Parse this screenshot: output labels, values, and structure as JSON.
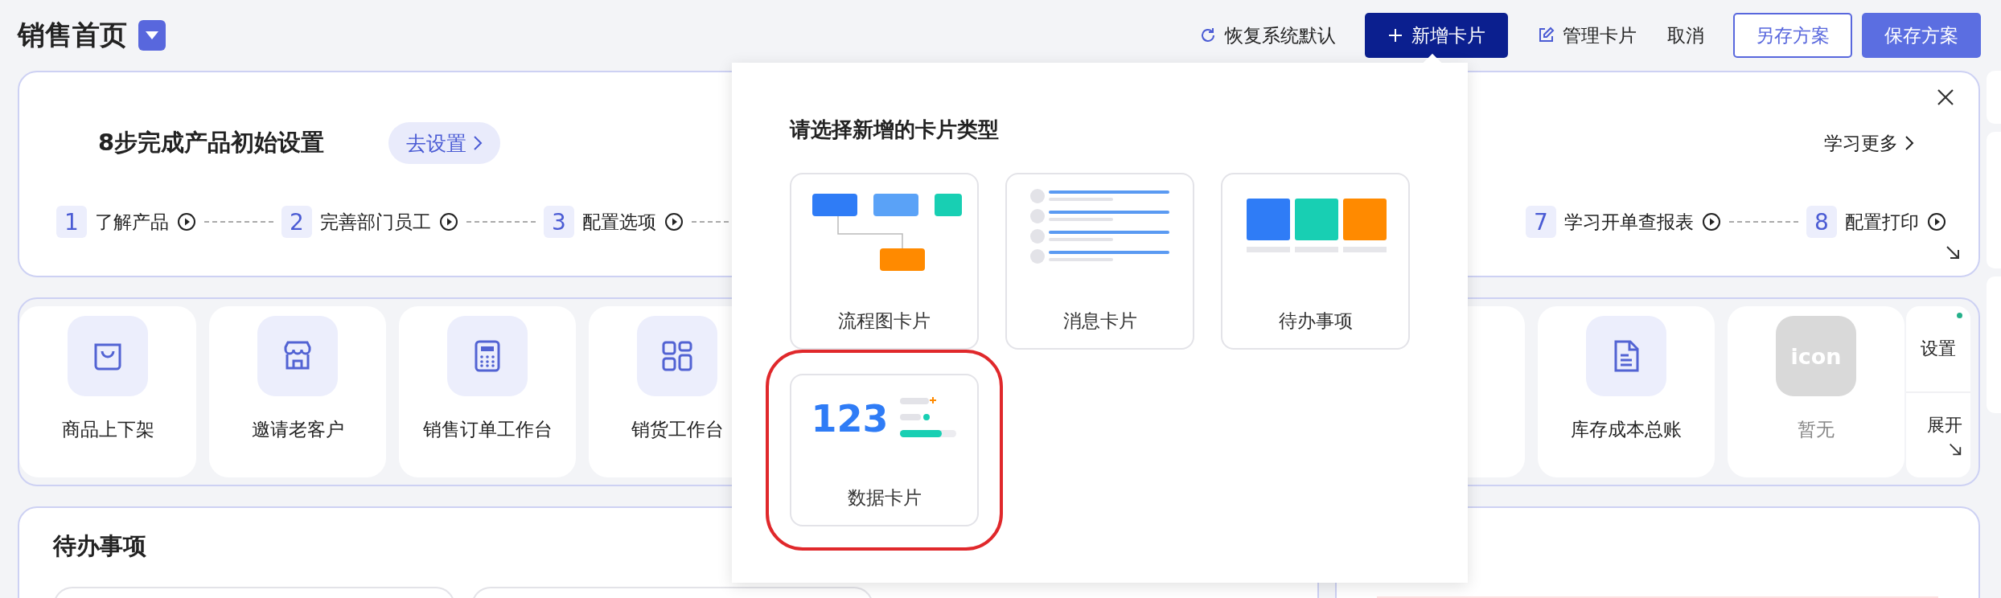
{
  "page": {
    "title": "销售首页"
  },
  "toolbar": [
    {
      "kind": "reset",
      "label": "恢复系统默认"
    },
    {
      "kind": "add",
      "label": "新增卡片"
    },
    {
      "kind": "manage",
      "label": "管理卡片"
    },
    {
      "kind": "cancel",
      "label": "取消"
    },
    {
      "kind": "save-as",
      "label": "另存方案"
    },
    {
      "kind": "save",
      "label": "保存方案"
    }
  ],
  "setup": {
    "title": "8步完成产品初始设置",
    "action": "去设置",
    "more": "学习更多",
    "steps_start": [
      {
        "number": "1",
        "label": "了解产品"
      },
      {
        "number": "2",
        "label": "完善部门员工"
      },
      {
        "number": "3",
        "label": "配置选项"
      }
    ],
    "steps_end": [
      {
        "number": "7",
        "label": "学习开单查报表"
      },
      {
        "number": "8",
        "label": "配置打印"
      }
    ]
  },
  "shortcuts": {
    "items_start": [
      {
        "kind": "bag",
        "label": "商品上下架"
      },
      {
        "kind": "store",
        "label": "邀请老客户"
      },
      {
        "kind": "calculator",
        "label": "销售订单工作台"
      },
      {
        "kind": "grid",
        "label": "销货工作台"
      }
    ],
    "items_end": [
      {
        "kind": "doc",
        "label": "库存成本总账"
      },
      {
        "kind": "placeholder",
        "label": "暂无",
        "icon_text": "icon"
      }
    ],
    "settings": "设置",
    "expand": "展开"
  },
  "todo": {
    "title": "待办事项"
  },
  "popup": {
    "title": "请选择新增的卡片类型",
    "cards": [
      {
        "kind": "flow",
        "label": "流程图卡片",
        "selected": false
      },
      {
        "kind": "message",
        "label": "消息卡片",
        "selected": false
      },
      {
        "kind": "todo",
        "label": "待办事项",
        "selected": false
      },
      {
        "kind": "data",
        "label": "数据卡片",
        "figure": "123",
        "selected": true
      }
    ]
  }
}
